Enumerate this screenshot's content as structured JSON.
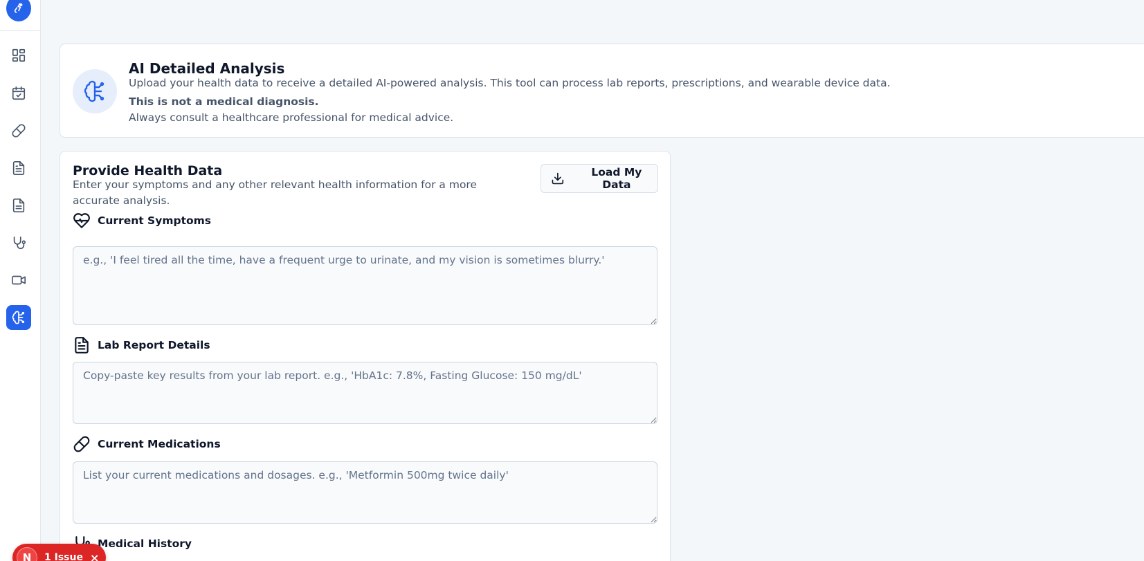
{
  "sidebar": {
    "logo": "brain-logo-icon",
    "items": [
      {
        "name": "dashboard",
        "icon": "dashboard-icon"
      },
      {
        "name": "calendar",
        "icon": "calendar-check-icon"
      },
      {
        "name": "medications",
        "icon": "pill-icon"
      },
      {
        "name": "documents",
        "icon": "file-text-icon"
      },
      {
        "name": "reports",
        "icon": "file-lines-icon"
      },
      {
        "name": "doctors",
        "icon": "stethoscope-icon"
      },
      {
        "name": "video",
        "icon": "video-icon"
      },
      {
        "name": "ai-analysis",
        "icon": "brain-icon",
        "active": true
      }
    ]
  },
  "banner": {
    "icon": "brain-icon",
    "title": "AI Detailed Analysis",
    "description": "Upload your health data to receive a detailed AI-powered analysis. This tool can process lab reports, prescriptions, and wearable device data.",
    "warning": "This is not a medical diagnosis.",
    "note": "Always consult a healthcare professional for medical advice."
  },
  "form": {
    "title": "Provide Health Data",
    "description": "Enter your symptoms and any other relevant health information for a more accurate analysis.",
    "load_button": "Load My Data",
    "fields": {
      "symptoms": {
        "label": "Current Symptoms",
        "icon": "heart-pulse-icon",
        "value": "",
        "placeholder": "e.g., 'I feel tired all the time, have a frequent urge to urinate, and my vision is sometimes blurry.'"
      },
      "lab": {
        "label": "Lab Report Details",
        "icon": "file-text-icon",
        "value": "",
        "placeholder": "Copy-paste key results from your lab report. e.g., 'HbA1c: 7.8%, Fasting Glucose: 150 mg/dL'"
      },
      "meds": {
        "label": "Current Medications",
        "icon": "pill-icon",
        "value": "",
        "placeholder": "List your current medications and dosages. e.g., 'Metformin 500mg twice daily'"
      },
      "history": {
        "label": "Medical History",
        "icon": "stethoscope-icon"
      }
    }
  },
  "issue_badge": {
    "avatar": "N",
    "label": "1 Issue",
    "close": "×"
  },
  "colors": {
    "accent": "#2563eb",
    "background": "#f4f7fa",
    "danger": "#dc2626",
    "muted_text": "#475569"
  }
}
